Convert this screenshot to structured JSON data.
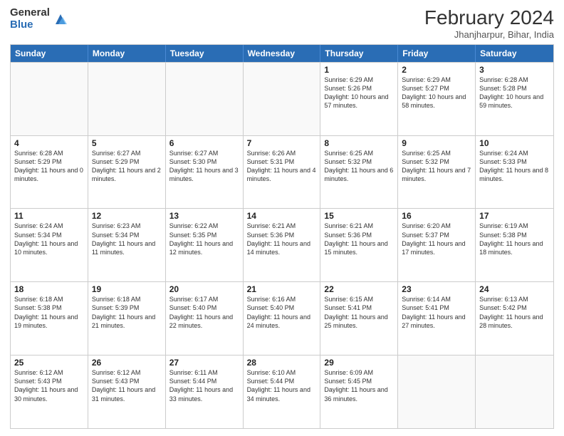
{
  "logo": {
    "general": "General",
    "blue": "Blue"
  },
  "header": {
    "month_year": "February 2024",
    "location": "Jhanjharpur, Bihar, India"
  },
  "days_of_week": [
    "Sunday",
    "Monday",
    "Tuesday",
    "Wednesday",
    "Thursday",
    "Friday",
    "Saturday"
  ],
  "weeks": [
    [
      {
        "day": "",
        "empty": true
      },
      {
        "day": "",
        "empty": true
      },
      {
        "day": "",
        "empty": true
      },
      {
        "day": "",
        "empty": true
      },
      {
        "day": "1",
        "sunrise": "6:29 AM",
        "sunset": "5:26 PM",
        "daylight": "10 hours and 57 minutes."
      },
      {
        "day": "2",
        "sunrise": "6:29 AM",
        "sunset": "5:27 PM",
        "daylight": "10 hours and 58 minutes."
      },
      {
        "day": "3",
        "sunrise": "6:28 AM",
        "sunset": "5:28 PM",
        "daylight": "10 hours and 59 minutes."
      }
    ],
    [
      {
        "day": "4",
        "sunrise": "6:28 AM",
        "sunset": "5:29 PM",
        "daylight": "11 hours and 0 minutes."
      },
      {
        "day": "5",
        "sunrise": "6:27 AM",
        "sunset": "5:29 PM",
        "daylight": "11 hours and 2 minutes."
      },
      {
        "day": "6",
        "sunrise": "6:27 AM",
        "sunset": "5:30 PM",
        "daylight": "11 hours and 3 minutes."
      },
      {
        "day": "7",
        "sunrise": "6:26 AM",
        "sunset": "5:31 PM",
        "daylight": "11 hours and 4 minutes."
      },
      {
        "day": "8",
        "sunrise": "6:25 AM",
        "sunset": "5:32 PM",
        "daylight": "11 hours and 6 minutes."
      },
      {
        "day": "9",
        "sunrise": "6:25 AM",
        "sunset": "5:32 PM",
        "daylight": "11 hours and 7 minutes."
      },
      {
        "day": "10",
        "sunrise": "6:24 AM",
        "sunset": "5:33 PM",
        "daylight": "11 hours and 8 minutes."
      }
    ],
    [
      {
        "day": "11",
        "sunrise": "6:24 AM",
        "sunset": "5:34 PM",
        "daylight": "11 hours and 10 minutes."
      },
      {
        "day": "12",
        "sunrise": "6:23 AM",
        "sunset": "5:34 PM",
        "daylight": "11 hours and 11 minutes."
      },
      {
        "day": "13",
        "sunrise": "6:22 AM",
        "sunset": "5:35 PM",
        "daylight": "11 hours and 12 minutes."
      },
      {
        "day": "14",
        "sunrise": "6:21 AM",
        "sunset": "5:36 PM",
        "daylight": "11 hours and 14 minutes."
      },
      {
        "day": "15",
        "sunrise": "6:21 AM",
        "sunset": "5:36 PM",
        "daylight": "11 hours and 15 minutes."
      },
      {
        "day": "16",
        "sunrise": "6:20 AM",
        "sunset": "5:37 PM",
        "daylight": "11 hours and 17 minutes."
      },
      {
        "day": "17",
        "sunrise": "6:19 AM",
        "sunset": "5:38 PM",
        "daylight": "11 hours and 18 minutes."
      }
    ],
    [
      {
        "day": "18",
        "sunrise": "6:18 AM",
        "sunset": "5:38 PM",
        "daylight": "11 hours and 19 minutes."
      },
      {
        "day": "19",
        "sunrise": "6:18 AM",
        "sunset": "5:39 PM",
        "daylight": "11 hours and 21 minutes."
      },
      {
        "day": "20",
        "sunrise": "6:17 AM",
        "sunset": "5:40 PM",
        "daylight": "11 hours and 22 minutes."
      },
      {
        "day": "21",
        "sunrise": "6:16 AM",
        "sunset": "5:40 PM",
        "daylight": "11 hours and 24 minutes."
      },
      {
        "day": "22",
        "sunrise": "6:15 AM",
        "sunset": "5:41 PM",
        "daylight": "11 hours and 25 minutes."
      },
      {
        "day": "23",
        "sunrise": "6:14 AM",
        "sunset": "5:41 PM",
        "daylight": "11 hours and 27 minutes."
      },
      {
        "day": "24",
        "sunrise": "6:13 AM",
        "sunset": "5:42 PM",
        "daylight": "11 hours and 28 minutes."
      }
    ],
    [
      {
        "day": "25",
        "sunrise": "6:12 AM",
        "sunset": "5:43 PM",
        "daylight": "11 hours and 30 minutes."
      },
      {
        "day": "26",
        "sunrise": "6:12 AM",
        "sunset": "5:43 PM",
        "daylight": "11 hours and 31 minutes."
      },
      {
        "day": "27",
        "sunrise": "6:11 AM",
        "sunset": "5:44 PM",
        "daylight": "11 hours and 33 minutes."
      },
      {
        "day": "28",
        "sunrise": "6:10 AM",
        "sunset": "5:44 PM",
        "daylight": "11 hours and 34 minutes."
      },
      {
        "day": "29",
        "sunrise": "6:09 AM",
        "sunset": "5:45 PM",
        "daylight": "11 hours and 36 minutes."
      },
      {
        "day": "",
        "empty": true
      },
      {
        "day": "",
        "empty": true
      }
    ]
  ]
}
